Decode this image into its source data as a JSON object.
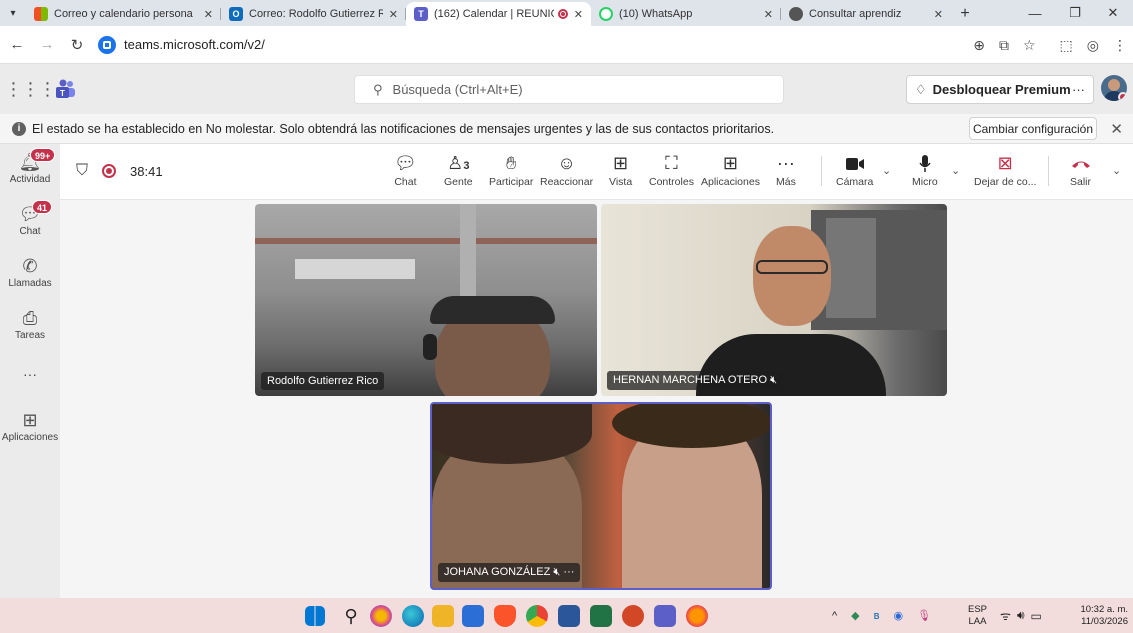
{
  "browser": {
    "tabs": [
      {
        "title": "Correo y calendario persona",
        "icon": "microsoft-icon",
        "color": "#f25022"
      },
      {
        "title": "Correo: Rodolfo Gutierrez Ri",
        "icon": "outlook-icon",
        "color": "#0f6cbd"
      },
      {
        "title": "(162) Calendar | REUNIÓ",
        "icon": "teams-icon",
        "color": "#5b5fc7",
        "active": true
      },
      {
        "title": "(10) WhatsApp",
        "icon": "whatsapp-icon",
        "color": "#25d366"
      },
      {
        "title": "Consultar aprendiz",
        "icon": "globe-icon",
        "color": "#555555"
      }
    ],
    "url": "teams.microsoft.com/v2/"
  },
  "teams": {
    "search_placeholder": "Búsqueda (Ctrl+Alt+E)",
    "premium_label": "Desbloquear Premium",
    "premium_more": "···"
  },
  "banner": {
    "message": "El estado se ha establecido en No molestar. Solo obtendrá las notificaciones de mensajes urgentes y las de sus contactos prioritarios.",
    "button": "Cambiar configuración"
  },
  "rail": [
    {
      "label": "Actividad",
      "badge": "99+"
    },
    {
      "label": "Chat",
      "badge": "41"
    },
    {
      "label": "Llamadas",
      "badge": ""
    },
    {
      "label": "Tareas",
      "badge": ""
    },
    {
      "label": "···",
      "badge": ""
    },
    {
      "label": "Aplicaciones",
      "badge": ""
    }
  ],
  "meeting": {
    "timer": "38:41",
    "people_count": "3",
    "toolbar": {
      "chat": "Chat",
      "people": "Gente",
      "raise": "Participar",
      "react": "Reaccionar",
      "view": "Vista",
      "controls": "Controles",
      "apps": "Aplicaciones",
      "more": "Más",
      "camera": "Cámara",
      "mic": "Micro",
      "share": "Dejar de co...",
      "leave": "Salir"
    },
    "participants": [
      {
        "name": "Rodolfo Gutierrez Rico"
      },
      {
        "name": "HERNAN MARCHENA OTERO"
      },
      {
        "name": "JOHANA GONZÁLEZ"
      }
    ]
  },
  "taskbar": {
    "lang": "ESP",
    "lang_sub": "LAA",
    "time": "10:32 a. m.",
    "date": "11/03/2026"
  },
  "colors": {
    "accent": "#5b5fc7",
    "leave": "#c4314b"
  }
}
